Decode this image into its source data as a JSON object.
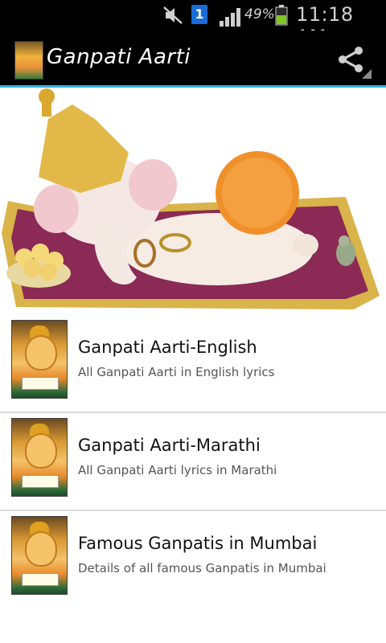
{
  "status_bar": {
    "notification_count": "1",
    "battery_percent": "49%",
    "time": "11:18 AM"
  },
  "action_bar": {
    "title": "Ganpati Aarti",
    "share_icon": "share-icon"
  },
  "colors": {
    "accent": "#33b5e5",
    "bar_bg": "#000000",
    "battery_green": "#7ec820",
    "notification_blue": "#1a6cd6"
  },
  "list": {
    "items": [
      {
        "title": "Ganpati Aarti-English",
        "subtitle": "All Ganpati Aarti in English lyrics"
      },
      {
        "title": "Ganpati Aarti-Marathi",
        "subtitle": "All Ganpati Aarti lyrics in Marathi"
      },
      {
        "title": "Famous Ganpatis in Mumbai",
        "subtitle": "Details of all famous Ganpatis in Mumbai"
      }
    ]
  }
}
